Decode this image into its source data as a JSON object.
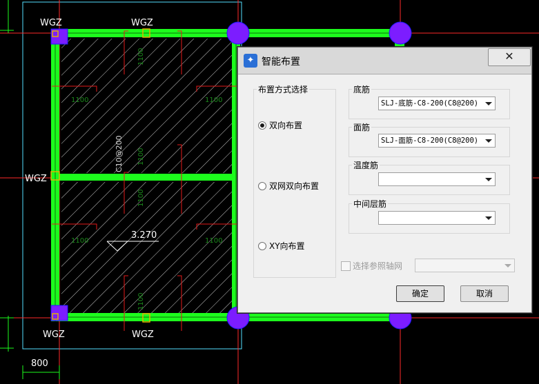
{
  "cad": {
    "wgz_labels": [
      "WGZ",
      "WGZ",
      "WGZ",
      "WGZ",
      "WGZ"
    ],
    "dim_label": "800",
    "beam_label": "C10@200",
    "elevation_label": "3.270",
    "rebar_lengths": [
      "1100",
      "1100",
      "1100",
      "1100",
      "1100",
      "1100",
      "1100",
      "1100",
      "1100",
      "1100",
      "1100",
      "1100"
    ],
    "colors": {
      "beam": "#1dfc1d",
      "column": "#7c1dff",
      "column_outline": "#1a1aff",
      "hatch": "#ffffff",
      "axis": "#ff2a2a",
      "outline": "#55e0ff",
      "rebar": "#e31a1a"
    }
  },
  "dialog": {
    "title": "智能布置",
    "close_label": "✕",
    "layout_group": {
      "label": "布置方式选择",
      "options": [
        {
          "label": "双向布置",
          "selected": true
        },
        {
          "label": "双网双向布置",
          "selected": false
        },
        {
          "label": "XY向布置",
          "selected": false
        }
      ]
    },
    "bottom_rebar": {
      "label": "底筋",
      "value": "SLJ-底筋-C8-200(C8@200)"
    },
    "top_rebar": {
      "label": "面筋",
      "value": "SLJ-面筋-C8-200(C8@200)"
    },
    "temp_rebar": {
      "label": "温度筋",
      "value": ""
    },
    "mid_rebar": {
      "label": "中间层筋",
      "value": ""
    },
    "axis_checkbox": {
      "label": "选择参照轴网",
      "checked": false,
      "value": ""
    },
    "ok_label": "确定",
    "cancel_label": "取消"
  }
}
